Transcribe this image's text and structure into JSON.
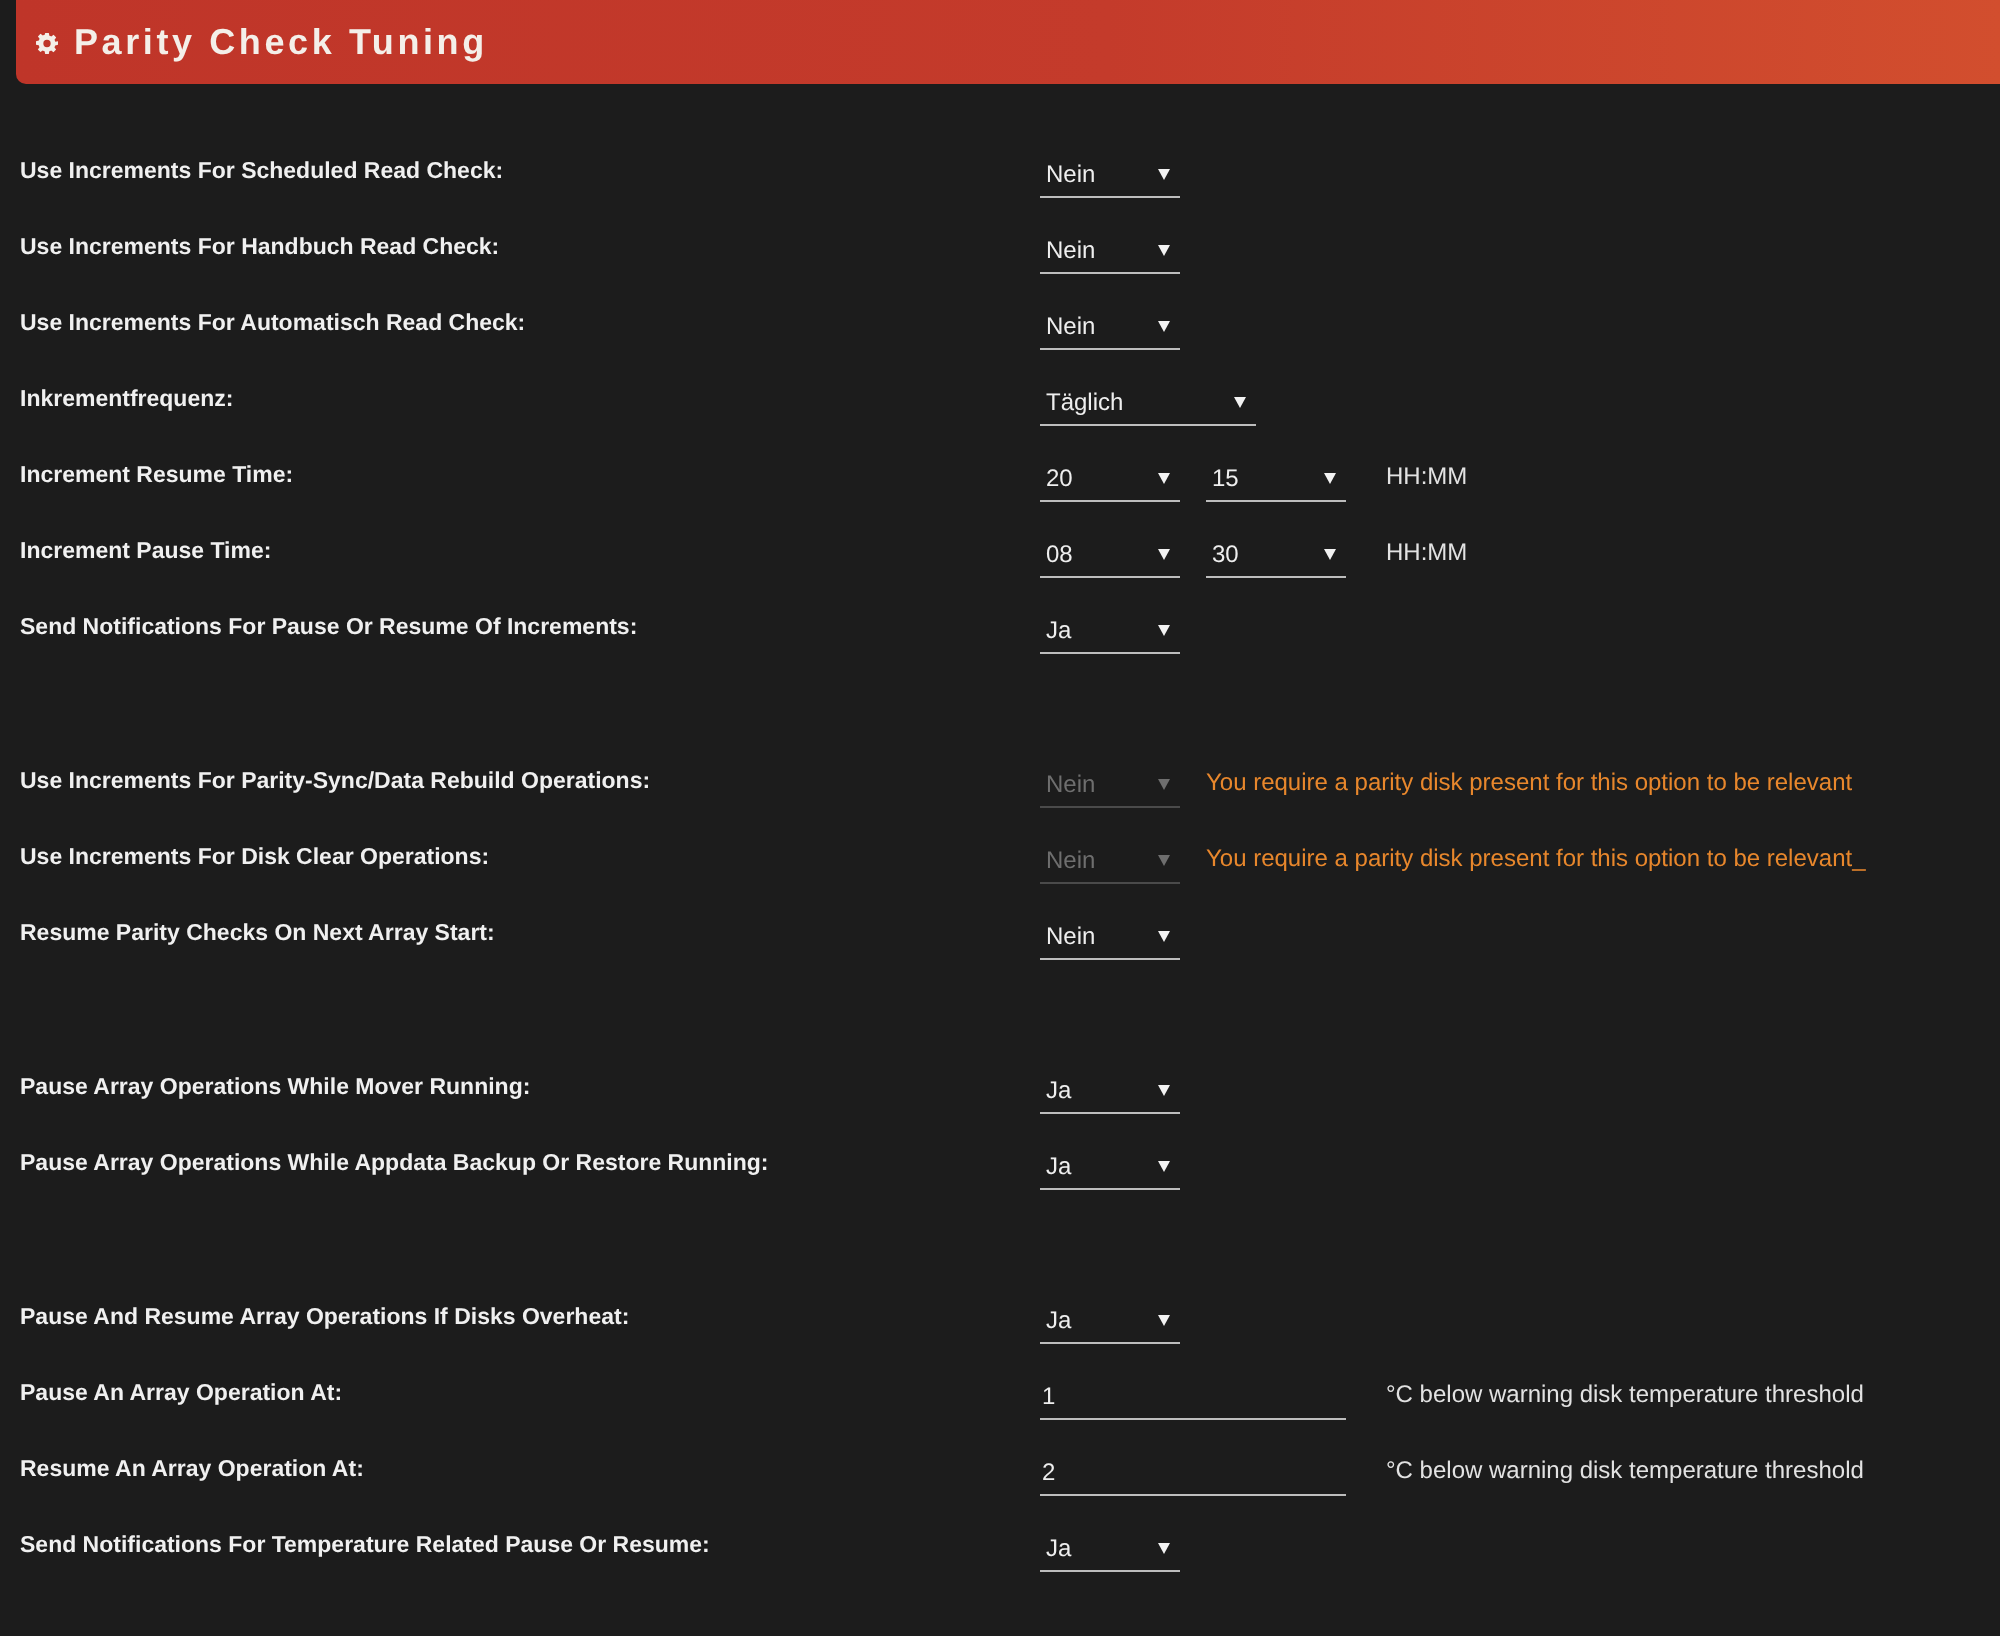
{
  "header": {
    "title": "Parity Check Tuning"
  },
  "sections": [
    {
      "rows": [
        {
          "label": "Use Increments For Scheduled Read Check:",
          "controls": [
            {
              "kind": "select",
              "value": "Nein",
              "disabled": false
            }
          ]
        },
        {
          "label": "Use Increments For Handbuch Read Check:",
          "controls": [
            {
              "kind": "select",
              "value": "Nein",
              "disabled": false
            }
          ]
        },
        {
          "label": "Use Increments For Automatisch Read Check:",
          "controls": [
            {
              "kind": "select",
              "value": "Nein",
              "disabled": false
            }
          ]
        },
        {
          "label": "Inkrementfrequenz:",
          "controls": [
            {
              "kind": "wide-select",
              "value": "Täglich",
              "disabled": false
            }
          ]
        },
        {
          "label": "Increment Resume Time:",
          "controls": [
            {
              "kind": "select",
              "value": "20",
              "disabled": false
            },
            {
              "kind": "select",
              "value": "15",
              "disabled": false
            },
            {
              "kind": "unit",
              "text": "HH:MM"
            }
          ]
        },
        {
          "label": "Increment Pause Time:",
          "controls": [
            {
              "kind": "select",
              "value": "08",
              "disabled": false
            },
            {
              "kind": "select",
              "value": "30",
              "disabled": false
            },
            {
              "kind": "unit",
              "text": "HH:MM"
            }
          ]
        },
        {
          "label": "Send Notifications For Pause Or Resume Of Increments:",
          "controls": [
            {
              "kind": "select",
              "value": "Ja",
              "disabled": false
            }
          ]
        }
      ]
    },
    {
      "rows": [
        {
          "label": "Use Increments For Parity-Sync/Data Rebuild Operations:",
          "controls": [
            {
              "kind": "select",
              "value": "Nein",
              "disabled": true
            },
            {
              "kind": "warning",
              "text": "You require a parity disk present for this option to be relevant"
            }
          ]
        },
        {
          "label": "Use Increments For Disk Clear Operations:",
          "controls": [
            {
              "kind": "select",
              "value": "Nein",
              "disabled": true
            },
            {
              "kind": "warning",
              "text": "You require a parity disk present for this option to be relevant_"
            }
          ]
        },
        {
          "label": "Resume Parity Checks On Next Array Start:",
          "controls": [
            {
              "kind": "select",
              "value": "Nein",
              "disabled": false
            }
          ]
        }
      ]
    },
    {
      "rows": [
        {
          "label": "Pause Array Operations While Mover Running:",
          "controls": [
            {
              "kind": "select",
              "value": "Ja",
              "disabled": false
            }
          ]
        },
        {
          "label": "Pause Array Operations While Appdata Backup Or Restore Running:",
          "controls": [
            {
              "kind": "select",
              "value": "Ja",
              "disabled": false
            }
          ]
        }
      ]
    },
    {
      "rows": [
        {
          "label": "Pause And Resume Array Operations If Disks Overheat:",
          "controls": [
            {
              "kind": "select",
              "value": "Ja",
              "disabled": false
            }
          ]
        },
        {
          "label": "Pause An Array Operation At:",
          "controls": [
            {
              "kind": "text-input",
              "value": "1"
            },
            {
              "kind": "unit",
              "text": "°C below warning disk temperature threshold"
            }
          ]
        },
        {
          "label": "Resume An Array Operation At:",
          "controls": [
            {
              "kind": "text-input",
              "value": "2"
            },
            {
              "kind": "unit",
              "text": "°C below warning disk temperature threshold"
            }
          ]
        },
        {
          "label": "Send Notifications For Temperature Related Pause Or Resume:",
          "controls": [
            {
              "kind": "select",
              "value": "Ja",
              "disabled": false
            }
          ]
        }
      ]
    }
  ]
}
